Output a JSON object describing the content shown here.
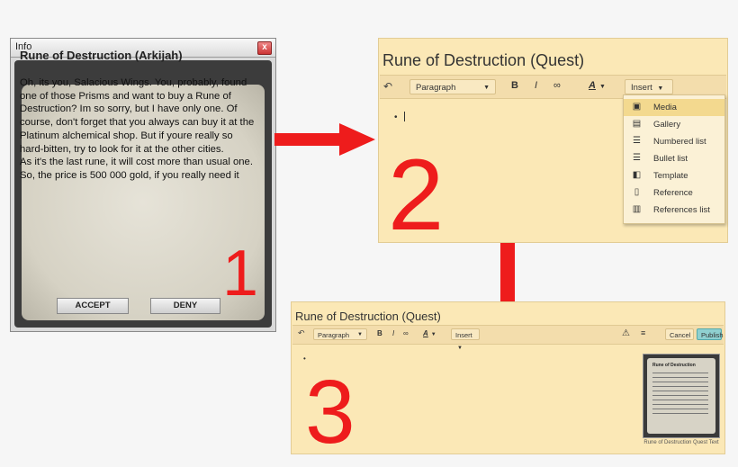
{
  "panel1": {
    "window_title": "Info",
    "close_glyph": "x",
    "heading": "Rune of Destruction (Arkijah)",
    "body": "Oh, its you, Salacious Wings. You, probably, found one of those Prisms and want to buy a Rune of Destruction? Im so sorry, but I have only one. Of course, don't forget that you always can buy it at the Platinum alchemical shop. But if youre really so hard-bitten, try to look for it at the other cities.\nAs it's the last rune, it will cost more than usual one. So, the price is 500 000 gold, if you really need it",
    "accept_label": "ACCEPT",
    "deny_label": "DENY",
    "step_number": "1"
  },
  "panel2": {
    "title": "Rune of Destruction (Quest)",
    "toolbar": {
      "undo_icon": "↶",
      "paragraph": "Paragraph",
      "bold": "B",
      "italic": "I",
      "link_icon": "∞",
      "text_color": "A",
      "insert": "Insert"
    },
    "bullet": "•",
    "menu": [
      {
        "label": "Media",
        "icon": "media-icon",
        "glyph": "▣",
        "selected": true
      },
      {
        "label": "Gallery",
        "icon": "gallery-icon",
        "glyph": "▤",
        "selected": false
      },
      {
        "label": "Numbered list",
        "icon": "numbered-list-icon",
        "glyph": "☰",
        "selected": false
      },
      {
        "label": "Bullet list",
        "icon": "bullet-list-icon",
        "glyph": "☰",
        "selected": false
      },
      {
        "label": "Template",
        "icon": "template-icon",
        "glyph": "◧",
        "selected": false
      },
      {
        "label": "Reference",
        "icon": "reference-icon",
        "glyph": "▯",
        "selected": false
      },
      {
        "label": "References list",
        "icon": "references-list-icon",
        "glyph": "▥",
        "selected": false
      }
    ],
    "step_number": "2"
  },
  "panel3": {
    "title": "Rune of Destruction (Quest)",
    "toolbar": {
      "undo_icon": "↶",
      "paragraph": "Paragraph",
      "bold": "B",
      "italic": "I",
      "link_icon": "∞",
      "text_color": "A",
      "insert": "Insert",
      "warning_icon": "⚠",
      "list_icon": "≡",
      "cancel": "Cancel",
      "publish": "Publish"
    },
    "bullet": "•",
    "thumbnail_heading": "Rune of Destruction",
    "thumbnail_caption": "Rune of Destruction Quest Text",
    "step_number": "3"
  },
  "colors": {
    "accent_red": "#ee1c1c",
    "editor_bg": "#fbe8b6",
    "menu_highlight": "#f3d98f"
  }
}
